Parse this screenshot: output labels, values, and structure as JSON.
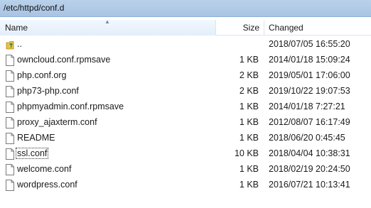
{
  "path": "/etc/httpd/conf.d",
  "columns": {
    "name": "Name",
    "size": "Size",
    "changed": "Changed"
  },
  "files": [
    {
      "name": "..",
      "size": "",
      "changed": "2018/07/05 16:55:20",
      "icon": "folder-up-icon"
    },
    {
      "name": "owncloud.conf.rpmsave",
      "size": "1 KB",
      "changed": "2014/01/18 15:09:24",
      "icon": "file-icon"
    },
    {
      "name": "php.conf.org",
      "size": "2 KB",
      "changed": "2019/05/01 17:06:00",
      "icon": "file-icon"
    },
    {
      "name": "php73-php.conf",
      "size": "2 KB",
      "changed": "2019/10/22 19:07:53",
      "icon": "file-icon"
    },
    {
      "name": "phpmyadmin.conf.rpmsave",
      "size": "1 KB",
      "changed": "2014/01/18 7:27:21",
      "icon": "file-icon"
    },
    {
      "name": "proxy_ajaxterm.conf",
      "size": "1 KB",
      "changed": "2012/08/07 16:17:49",
      "icon": "file-icon"
    },
    {
      "name": "README",
      "size": "1 KB",
      "changed": "2018/06/20 0:45:45",
      "icon": "file-icon"
    },
    {
      "name": "ssl.conf",
      "size": "10 KB",
      "changed": "2018/04/04 10:38:31",
      "icon": "file-icon"
    },
    {
      "name": "welcome.conf",
      "size": "1 KB",
      "changed": "2018/02/19 20:24:50",
      "icon": "file-icon"
    },
    {
      "name": "wordpress.conf",
      "size": "1 KB",
      "changed": "2016/07/21 10:13:41",
      "icon": "file-icon"
    }
  ],
  "focused_file": "ssl.conf"
}
